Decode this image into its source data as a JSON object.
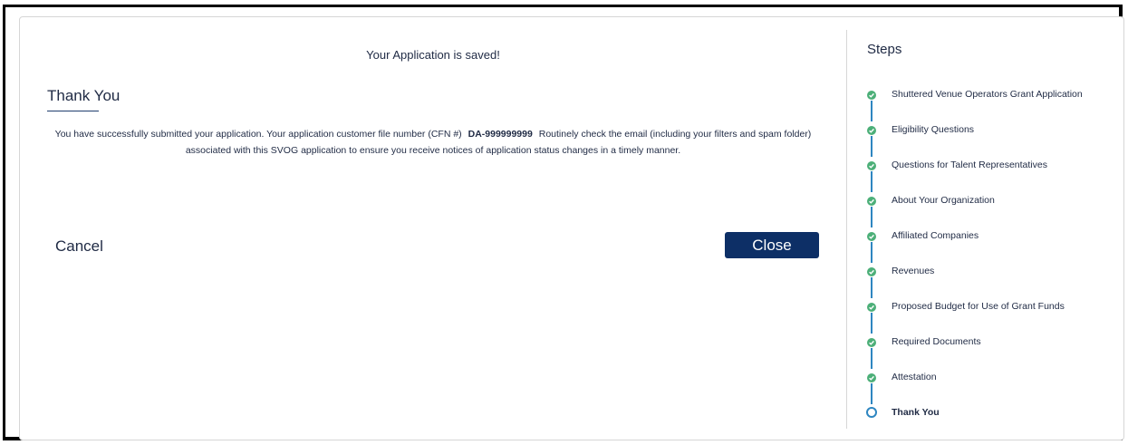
{
  "main": {
    "saved_message": "Your Application is saved!",
    "heading": "Thank You",
    "body_before_cfn": "You have successfully submitted your application. Your application customer file number (CFN #)",
    "cfn": "DA-999999999",
    "body_after_cfn": "Routinely check the email (including your filters and spam folder) associated with this SVOG application to ensure you receive notices of application status changes in a timely manner.",
    "cancel_label": "Cancel",
    "close_label": "Close"
  },
  "steps": {
    "title": "Steps",
    "items": [
      {
        "label": "Shuttered Venue Operators Grant Application",
        "status": "complete"
      },
      {
        "label": "Eligibility Questions",
        "status": "complete"
      },
      {
        "label": "Questions for Talent Representatives",
        "status": "complete"
      },
      {
        "label": "About Your Organization",
        "status": "complete"
      },
      {
        "label": "Affiliated Companies",
        "status": "complete"
      },
      {
        "label": "Revenues",
        "status": "complete"
      },
      {
        "label": "Proposed Budget for Use of Grant Funds",
        "status": "complete"
      },
      {
        "label": "Required Documents",
        "status": "complete"
      },
      {
        "label": "Attestation",
        "status": "complete"
      },
      {
        "label": "Thank You",
        "status": "current"
      }
    ]
  },
  "colors": {
    "primary": "#0d2f66",
    "complete": "#4caf78",
    "connector": "#2e86c1",
    "text": "#1f2a44"
  },
  "icons": {
    "complete_step": "check-circle-icon",
    "current_step": "open-circle-icon"
  }
}
